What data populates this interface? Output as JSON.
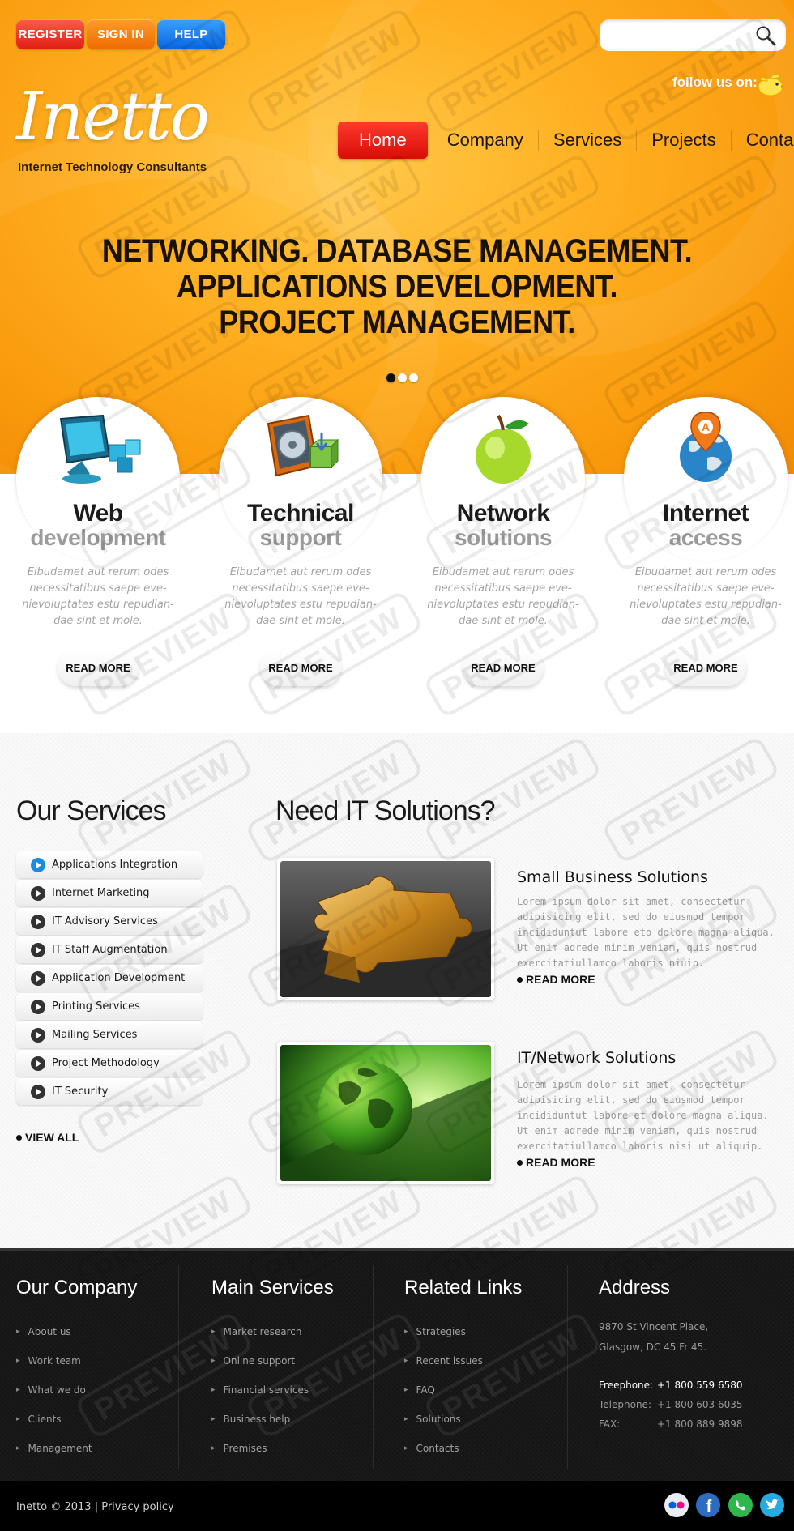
{
  "header": {
    "buttons": {
      "register": "REGISTER",
      "sign_in": "SIGN IN",
      "help": "HELP"
    },
    "search": {
      "placeholder": "",
      "icon": "search-icon"
    },
    "follow_text": "follow us on:",
    "logo": "Inetto",
    "tagline": "Internet Technology Consultants",
    "nav": [
      "Home",
      "Company",
      "Services",
      "Projects",
      "Contacts"
    ],
    "active_nav": "Home"
  },
  "hero": {
    "lines": [
      "NETWORKING. DATABASE MANAGEMENT.",
      "APPLICATIONS DEVELOPMENT.",
      "PROJECT MANAGEMENT."
    ],
    "slides": 3,
    "active_slide": 1
  },
  "features": [
    {
      "icon": "computer-icon",
      "title": "Web",
      "subtitle": "development",
      "text": "Eibudamet aut rerum odes necessitatibus saepe eve-nievoluptates estu repudian-dae sint et mole.",
      "button": "READ MORE"
    },
    {
      "icon": "server-icon",
      "title": "Technical",
      "subtitle": "support",
      "text": "Eibudamet aut rerum odes necessitatibus saepe eve-nievoluptates estu repudian-dae sint et mole.",
      "button": "READ MORE"
    },
    {
      "icon": "apple-icon",
      "title": "Network",
      "subtitle": "solutions",
      "text": "Eibudamet aut rerum odes necessitatibus saepe eve-nievoluptates estu repudian-dae sint et mole.",
      "button": "READ MORE"
    },
    {
      "icon": "globe-pin-icon",
      "title": "Internet",
      "subtitle": "access",
      "text": "Eibudamet aut rerum odes necessitatibus saepe eve-nievoluptates estu repudian-dae sint et mole.",
      "button": "READ MORE"
    }
  ],
  "services": {
    "title": "Our Services",
    "items": [
      "Applications Integration",
      "Internet Marketing",
      "IT Advisory Services",
      "IT Staff Augmentation",
      "Application Development",
      "Printing Services",
      "Mailing Services",
      "Project Methodology",
      "IT Security"
    ],
    "active_item": "Applications Integration",
    "view_all": "VIEW ALL"
  },
  "solutions": {
    "title": "Need IT Solutions?",
    "items": [
      {
        "title": "Small Business Solutions",
        "image": "puzzle-image",
        "text": "Lorem ipsum dolor sit amet, consectetur adipisicing elit, sed do eiusmod tempor incididuntut labore eto dolore magna aliqua. Ut enim adrede minim veniam, quis nostrud exercitatiullamco laboris niuip.",
        "link": "READ MORE"
      },
      {
        "title": "IT/Network Solutions",
        "image": "globe-image",
        "text": "Lorem ipsum dolor sit amet, consectetur adipisicing elit, sed do eiusmod tempor incididuntut labore et dolore magna aliqua. Ut enim adrede minim veniam, quis nostrud exercitatiullamco laboris nisi ut aliquip.",
        "link": "READ MORE"
      }
    ]
  },
  "footer": {
    "company": {
      "title": "Our Company",
      "links": [
        "About us",
        "Work team",
        "What we do",
        "Clients",
        "Management"
      ]
    },
    "main_services": {
      "title": "Main Services",
      "links": [
        "Market research",
        "Online support",
        "Financial services",
        "Business help",
        "Premises"
      ]
    },
    "related": {
      "title": "Related Links",
      "links": [
        "Strategies",
        "Recent issues",
        "FAQ",
        "Solutions",
        "Contacts"
      ]
    },
    "address": {
      "title": "Address",
      "street": "9870 St Vincent Place,",
      "city": "Glasgow, DC 45 Fr 45.",
      "freephone_label": "Freephone:",
      "freephone": "+1 800 559 6580",
      "telephone_label": "Telephone:",
      "telephone": "+1 800 603 6035",
      "fax_label": "FAX:",
      "fax": "+1 800 889 9898"
    },
    "copyright": "Inetto © 2013 | Privacy policy",
    "social": [
      "flickr-icon",
      "facebook-icon",
      "skype-icon",
      "twitter-icon"
    ]
  },
  "watermark": "PREVIEW",
  "colors": {
    "accent_red": "#e01e12",
    "hero_orange": "#ffb224",
    "help_blue": "#0866e0"
  }
}
